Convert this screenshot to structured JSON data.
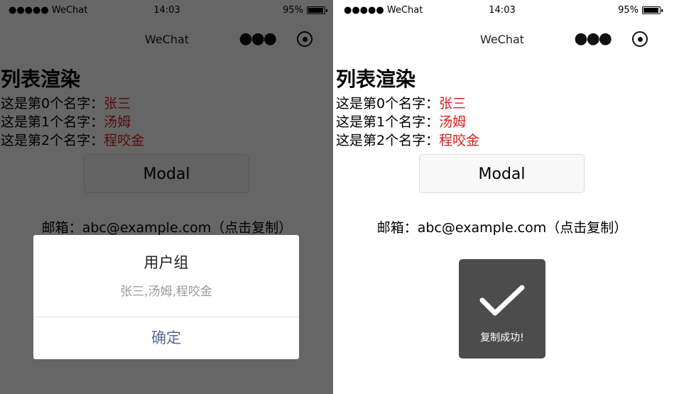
{
  "status": {
    "carrier": "●●●●● WeChat",
    "time": "14:03",
    "battery": "95%",
    "battery_level": 0.95
  },
  "nav": {
    "title": "WeChat",
    "menu_icon": "more-dots-icon",
    "record_icon": "record-circle-icon"
  },
  "page": {
    "heading": "列表渲染",
    "items": [
      {
        "prefix": "这是第0个名字：",
        "name": "张三"
      },
      {
        "prefix": "这是第1个名字：",
        "name": "汤姆"
      },
      {
        "prefix": "这是第2个名字：",
        "name": "程咬金"
      }
    ],
    "modal_button": "Modal",
    "email": "邮箱：abc@example.com（点击复制）"
  },
  "dialog": {
    "title": "用户组",
    "content": "张三,汤姆,程咬金",
    "confirm": "确定",
    "confirm_color": "#576b95"
  },
  "toast": {
    "icon": "checkmark-icon",
    "text": "复制成功!"
  },
  "colors": {
    "name_text": "#d42020",
    "mask": "rgba(0,0,0,0.6)",
    "toast_bg": "#4c4c4c"
  }
}
